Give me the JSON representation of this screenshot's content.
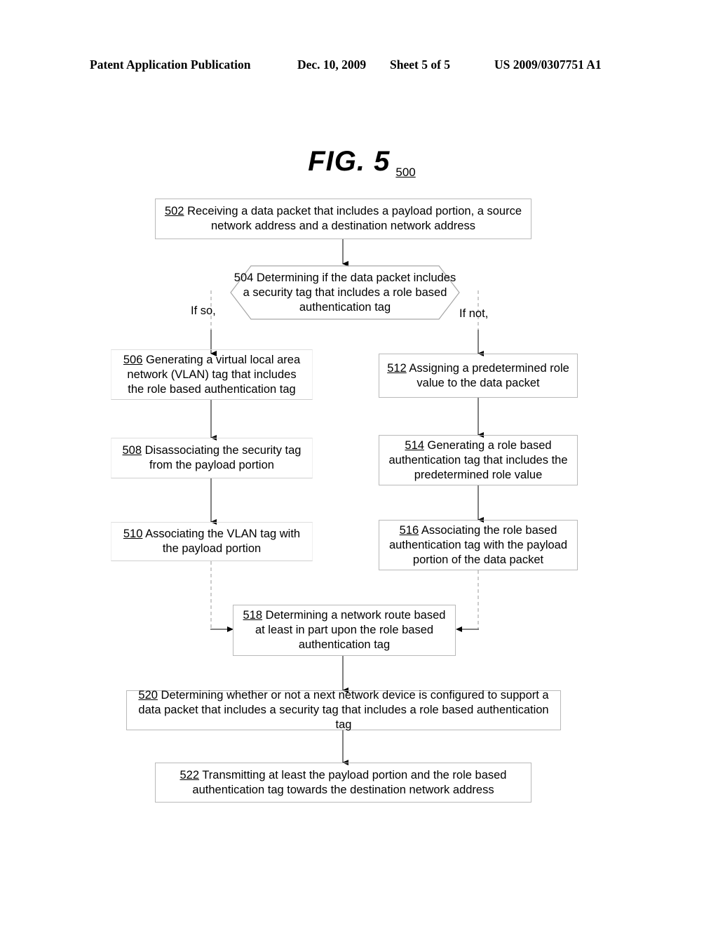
{
  "header": {
    "publication": "Patent Application Publication",
    "date": "Dec. 10, 2009",
    "sheet": "Sheet 5 of 5",
    "patent_number": "US 2009/0307751 A1"
  },
  "figure": {
    "label": "FIG. 5",
    "reference_number": "500"
  },
  "branches": {
    "if_so": "If so,",
    "if_not": "If not,"
  },
  "steps": [
    {
      "id": "502",
      "number": "502",
      "text": "Receiving a data packet that includes a payload portion, a source network address and a destination network address",
      "shape": "rect"
    },
    {
      "id": "504",
      "number": "504",
      "text": "Determining if the data packet includes a security tag that includes a role based authentication tag",
      "shape": "hexagon"
    },
    {
      "id": "506",
      "number": "506",
      "text": "Generating a virtual local area network (VLAN) tag that includes the role based authentication tag",
      "shape": "rect"
    },
    {
      "id": "508",
      "number": "508",
      "text": "Disassociating the security tag from the payload portion",
      "shape": "rect"
    },
    {
      "id": "510",
      "number": "510",
      "text": "Associating the VLAN tag with the payload portion",
      "shape": "rect"
    },
    {
      "id": "512",
      "number": "512",
      "text": "Assigning a predetermined role value to the data packet",
      "shape": "rect"
    },
    {
      "id": "514",
      "number": "514",
      "text": "Generating a role based authentication tag that includes the predetermined role value",
      "shape": "rect"
    },
    {
      "id": "516",
      "number": "516",
      "text": "Associating the role based authentication tag with the payload portion of the data packet",
      "shape": "rect"
    },
    {
      "id": "518",
      "number": "518",
      "text": "Determining a network route based at least in part upon the role based authentication tag",
      "shape": "rect"
    },
    {
      "id": "520",
      "number": "520",
      "text": "Determining whether or not a next network device is configured to support a data packet that includes a security tag that includes a role based authentication tag",
      "shape": "rect"
    },
    {
      "id": "522",
      "number": "522",
      "text": "Transmitting at least the payload portion and the role based authentication tag towards the destination network address",
      "shape": "rect"
    }
  ],
  "colors": {
    "ink": "#000000",
    "box_border": "#b9b9b9",
    "faint_border": "#cfcfcf",
    "background": "#ffffff"
  }
}
